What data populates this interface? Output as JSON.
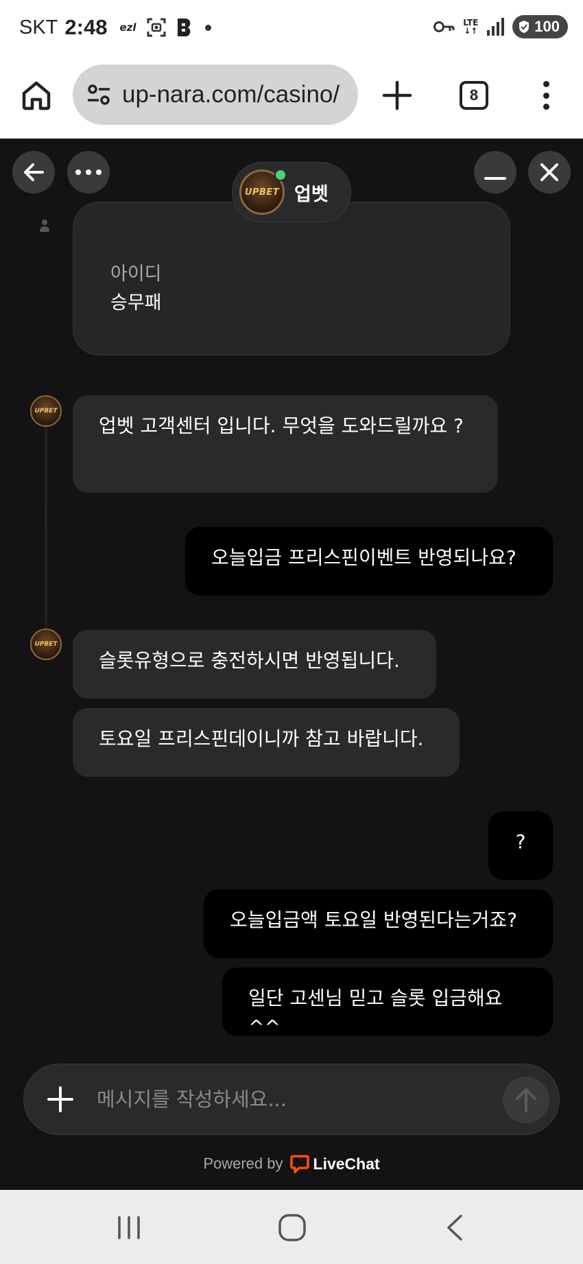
{
  "status_bar": {
    "carrier": "SKT",
    "time": "2:48",
    "ezl": "ezl",
    "battery": "100",
    "network": "LTE"
  },
  "browser": {
    "url": "up-nara.com/casino/",
    "tab_count": "8"
  },
  "chat": {
    "agent_name": "업벳",
    "agent_logo": "UPBET",
    "form": {
      "label": "아이디",
      "value": "승무패"
    },
    "messages": [
      {
        "from": "agent",
        "text": "업벳 고객센터 입니다. 무엇을 도와드릴까요 ?"
      },
      {
        "from": "user",
        "text": "오늘입금 프리스핀이벤트 반영되나요?"
      },
      {
        "from": "agent",
        "text": "슬롯유형으로 충전하시면 반영됩니다."
      },
      {
        "from": "agent",
        "text": "토요일 프리스핀데이니까 참고 바랍니다."
      },
      {
        "from": "user",
        "text": "?"
      },
      {
        "from": "user",
        "text": "오늘입금액 토요일 반영된다는거죠?"
      },
      {
        "from": "user",
        "text": "일단 고센님 믿고 슬롯 입금해요^^"
      }
    ],
    "composer_placeholder": "메시지를 작성하세요...",
    "powered_by": "Powered by",
    "brand": "LiveChat"
  },
  "colors": {
    "chat_bg": "#141214",
    "agent_bubble": "#2a2a2c",
    "user_bubble": "#000000",
    "online": "#4cd07d",
    "livechat_orange": "#ff5100"
  },
  "icons": [
    "home-icon",
    "tune-icon",
    "plus-icon",
    "tabs-icon",
    "more-vert-icon",
    "back-arrow-icon",
    "more-horiz-icon",
    "minimize-icon",
    "close-icon",
    "send-arrow-icon",
    "recents-icon",
    "nav-home-icon",
    "nav-back-icon"
  ]
}
